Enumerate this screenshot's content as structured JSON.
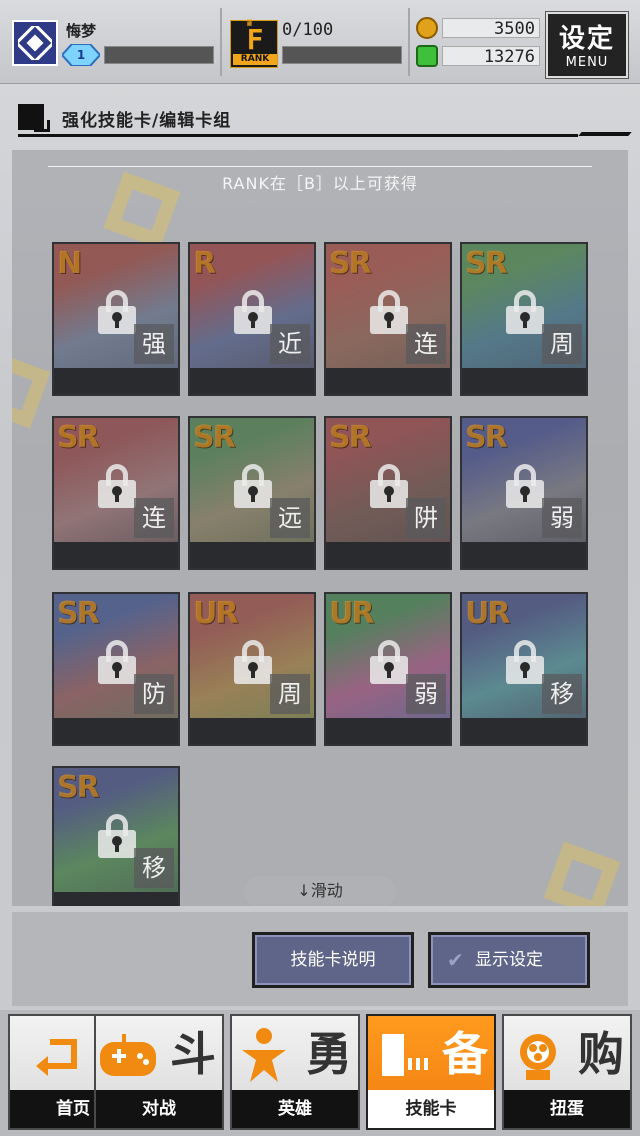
{
  "player": {
    "name": "悔梦",
    "level": "1"
  },
  "rank": {
    "letter": "F",
    "badge_label": "RANK",
    "progress": "0/100"
  },
  "currency": [
    {
      "icon": "gold-coin-icon",
      "symbol": "B",
      "value": "3500",
      "color": "#e0a21a"
    },
    {
      "icon": "green-energy-icon",
      "symbol": "E",
      "value": "13276",
      "color": "#3fbf3a"
    }
  ],
  "menu": {
    "label_cn": "设定",
    "label_en": "MENU"
  },
  "section": {
    "title": "强化技能卡/编辑卡组"
  },
  "panel": {
    "rank_note": "RANK在［B］以上可获得",
    "scroll_hint": "↓滑动"
  },
  "cards": [
    {
      "rarity": "N",
      "skill": "强",
      "colors": [
        "#b33326",
        "#6b7fa6",
        "#3a4c6e"
      ]
    },
    {
      "rarity": "R",
      "skill": "近",
      "colors": [
        "#b62b2b",
        "#4a5fa0",
        "#2a2a44"
      ]
    },
    {
      "rarity": "SR",
      "skill": "连",
      "colors": [
        "#c23a2a",
        "#a0563a",
        "#5a3a2a"
      ]
    },
    {
      "rarity": "SR",
      "skill": "周",
      "colors": [
        "#3a9a3a",
        "#2a7a9a",
        "#1a3a5a"
      ]
    },
    {
      "rarity": "SR",
      "skill": "连",
      "colors": [
        "#a83030",
        "#b07070",
        "#3a2a2a"
      ]
    },
    {
      "rarity": "SR",
      "skill": "远",
      "colors": [
        "#3a8a3a",
        "#9a8a5a",
        "#4a5a2a"
      ]
    },
    {
      "rarity": "SR",
      "skill": "阱",
      "colors": [
        "#aa2a2a",
        "#6a3a2a",
        "#3a2020"
      ]
    },
    {
      "rarity": "SR",
      "skill": "弱",
      "colors": [
        "#2a3a9a",
        "#7a7a8a",
        "#2a2a3a"
      ]
    },
    {
      "rarity": "SR",
      "skill": "防",
      "colors": [
        "#2a4aa0",
        "#a04a4a",
        "#4a6a3a"
      ]
    },
    {
      "rarity": "UR",
      "skill": "周",
      "colors": [
        "#b33a2a",
        "#c08a2a",
        "#6a8a2a"
      ]
    },
    {
      "rarity": "UR",
      "skill": "弱",
      "colors": [
        "#2a8a3a",
        "#c04a8a",
        "#3a5aaa"
      ]
    },
    {
      "rarity": "UR",
      "skill": "移",
      "colors": [
        "#2a3a8a",
        "#3aa0aa",
        "#1a2a4a"
      ]
    },
    {
      "rarity": "SR",
      "skill": "移",
      "colors": [
        "#2a3a8a",
        "#3a9a3a",
        "#1a4a2a"
      ]
    }
  ],
  "actions": {
    "card_info": "技能卡说明",
    "display_settings": "显示设定"
  },
  "tabs": [
    {
      "icon": "home-return-icon",
      "big": "",
      "label": "首页",
      "active": false
    },
    {
      "icon": "gamepad-icon",
      "big": "斗",
      "label": "对战",
      "active": false
    },
    {
      "icon": "hero-icon",
      "big": "勇",
      "label": "英雄",
      "active": false
    },
    {
      "icon": "card-icon",
      "big": "备",
      "label": "技能卡",
      "active": true
    },
    {
      "icon": "capsule-toy-icon",
      "big": "购",
      "label": "扭蛋",
      "active": false
    }
  ]
}
